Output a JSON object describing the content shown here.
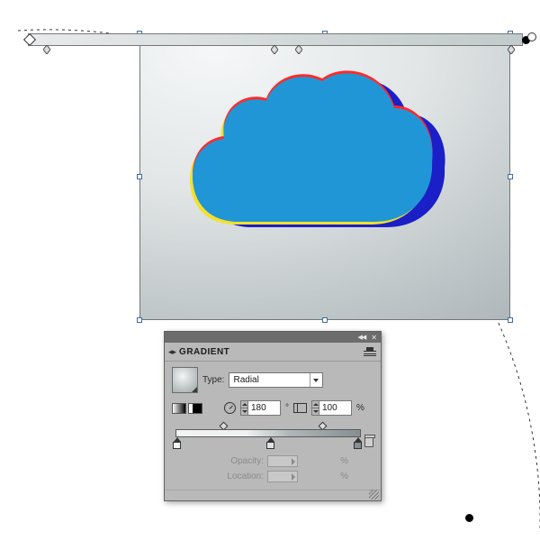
{
  "panel": {
    "title": "GRADIENT",
    "type_label": "Type:",
    "type_value": "Radial",
    "angle_value": "180",
    "angle_unit": "°",
    "aspect_value": "100",
    "aspect_unit": "%",
    "opacity_label": "Opacity:",
    "opacity_unit": "%",
    "location_label": "Location:",
    "location_unit": "%"
  },
  "gradient": {
    "stops": [
      {
        "position_pct": 0,
        "color": "#f2f3f3"
      },
      {
        "position_pct": 49,
        "color": "#dfe3e3"
      },
      {
        "position_pct": 100,
        "color": "#868f92"
      }
    ],
    "midpoints_pct": [
      25,
      75
    ]
  },
  "cloud": {
    "fill": "#2196d6",
    "shadow": "#1a1fc7",
    "hilite_top": "#ff2a2a",
    "hilite_bottom": "#f5e02a"
  },
  "annotator": {
    "stops_pct": [
      3,
      49,
      54,
      97
    ]
  }
}
